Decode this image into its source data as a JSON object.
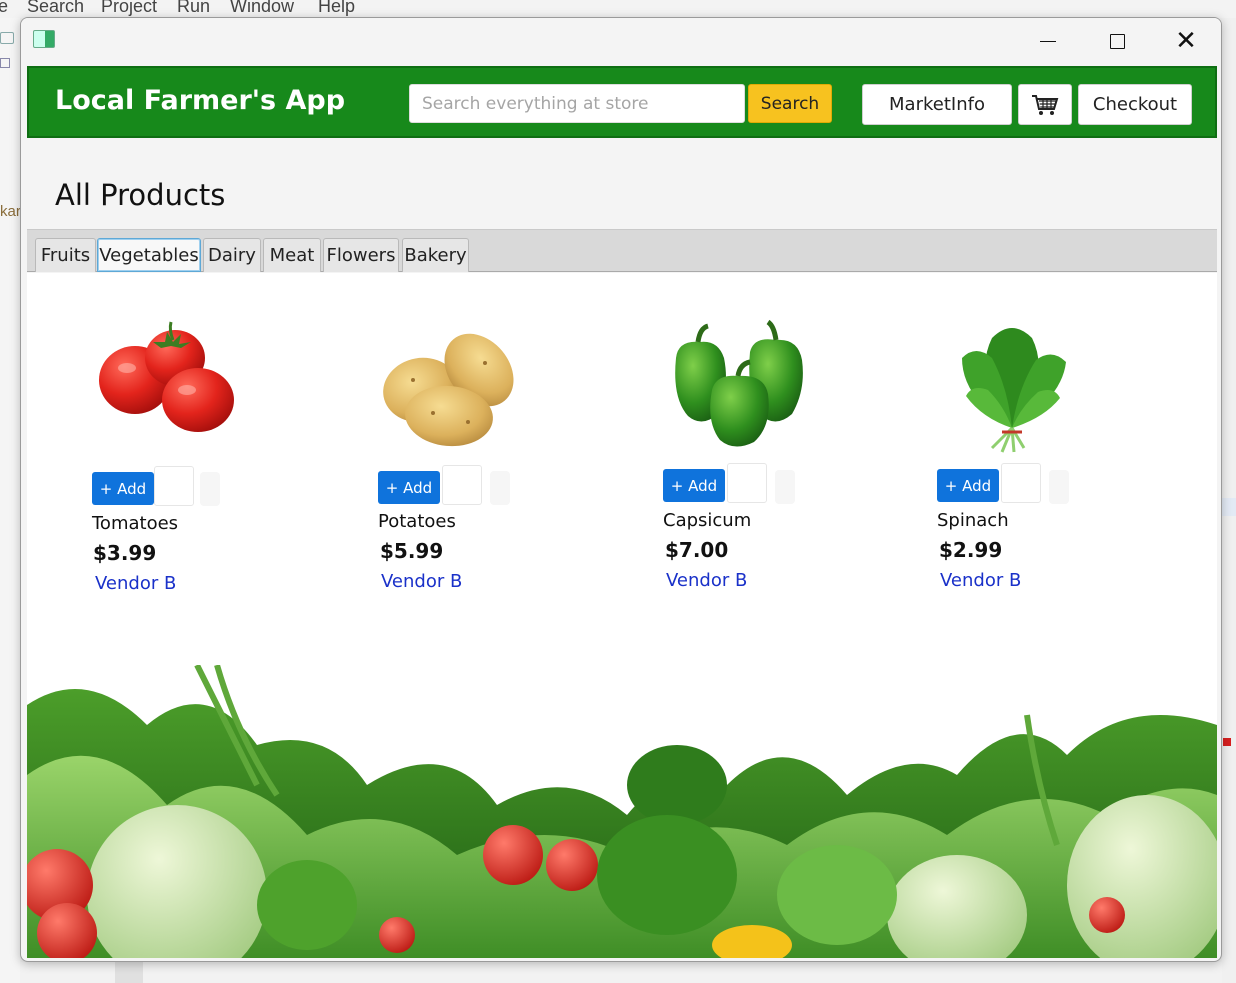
{
  "ide": {
    "menu": [
      "e",
      "Search",
      "Project",
      "Run",
      "Window",
      "Help"
    ],
    "side_text": "kar"
  },
  "window": {
    "minimize_glyph": "—",
    "maximize_glyph": "☐",
    "close_glyph": "✕"
  },
  "header": {
    "title": "Local Farmer's App",
    "search_placeholder": "Search everything at store",
    "search_label": "Search",
    "market_info_label": "MarketInfo",
    "cart_icon": "shopping-cart-icon",
    "checkout_label": "Checkout",
    "colors": {
      "header_bg": "#17891b",
      "search_button": "#f7c21f",
      "add_button": "#0f73dc",
      "vendor_link": "#1a31c9"
    }
  },
  "page_title": "All Products",
  "tabs": [
    {
      "label": "Fruits",
      "active": false
    },
    {
      "label": "Vegetables",
      "active": true
    },
    {
      "label": "Dairy",
      "active": false
    },
    {
      "label": "Meat",
      "active": false
    },
    {
      "label": "Flowers",
      "active": false
    },
    {
      "label": "Bakery",
      "active": false
    }
  ],
  "products": [
    {
      "name": "Tomatoes",
      "price": "$3.99",
      "vendor": "Vendor B",
      "add_label": "+ Add",
      "image": "tomatoes-image"
    },
    {
      "name": "Potatoes",
      "price": "$5.99",
      "vendor": "Vendor B",
      "add_label": "+ Add",
      "image": "potatoes-image"
    },
    {
      "name": "Capsicum",
      "price": "$7.00",
      "vendor": "Vendor B",
      "add_label": "+ Add",
      "image": "capsicum-image"
    },
    {
      "name": "Spinach",
      "price": "$2.99",
      "vendor": "Vendor B",
      "add_label": "+ Add",
      "image": "spinach-image"
    }
  ]
}
